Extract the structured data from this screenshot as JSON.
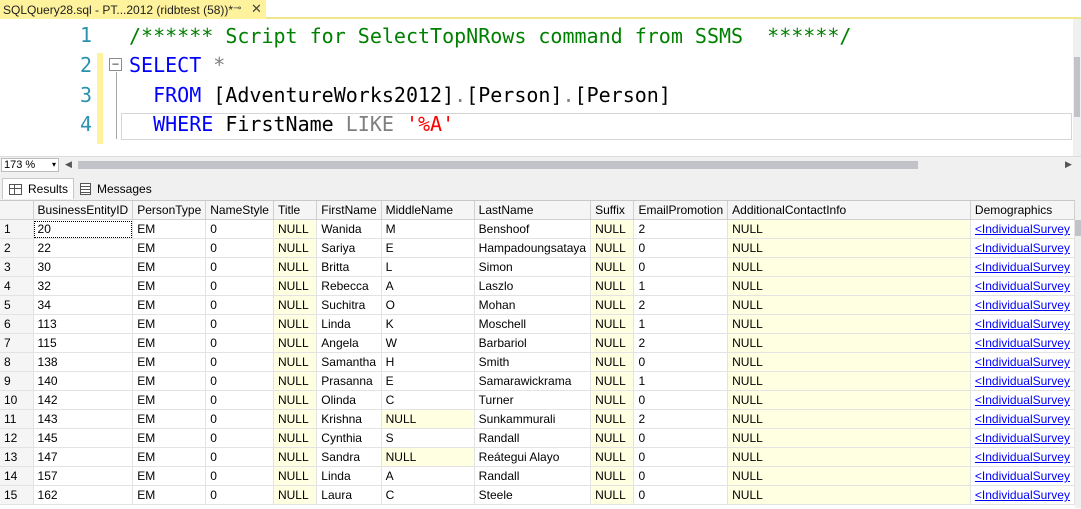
{
  "document_tab": {
    "title": "SQLQuery28.sql - PT...2012 (ridbtest (58))*",
    "pin_icon": "pin-icon",
    "close_icon": "close-icon"
  },
  "editor": {
    "line_numbers": [
      "1",
      "2",
      "3",
      "4"
    ],
    "lines": [
      {
        "parts": [
          {
            "t": "/****** Script for SelectTopNRows command from SSMS  ******/",
            "c": "cm"
          }
        ]
      },
      {
        "parts": [
          {
            "t": "SELECT",
            "c": "kw"
          },
          {
            "t": " *",
            "c": "gr"
          }
        ]
      },
      {
        "parts": [
          {
            "t": "  FROM",
            "c": "kw"
          },
          {
            "t": " [AdventureWorks2012]",
            "c": ""
          },
          {
            "t": ".",
            "c": "gr"
          },
          {
            "t": "[Person]",
            "c": ""
          },
          {
            "t": ".",
            "c": "gr"
          },
          {
            "t": "[Person]",
            "c": ""
          }
        ]
      },
      {
        "parts": [
          {
            "t": "  WHERE",
            "c": "kw"
          },
          {
            "t": " FirstName ",
            "c": ""
          },
          {
            "t": "LIKE",
            "c": "gr"
          },
          {
            "t": " ",
            "c": ""
          },
          {
            "t": "'%A'",
            "c": "str"
          }
        ]
      }
    ],
    "collapse_glyph": "−"
  },
  "zoom": {
    "value": "173 %",
    "arrow": "▾"
  },
  "result_tabs": {
    "results": "Results",
    "messages": "Messages"
  },
  "grid": {
    "columns": [
      "",
      "BusinessEntityID",
      "PersonType",
      "NameStyle",
      "Title",
      "FirstName",
      "MiddleName",
      "LastName",
      "Suffix",
      "EmailPromotion",
      "AdditionalContactInfo",
      "Demographics"
    ],
    "rows": [
      [
        "1",
        "20",
        "EM",
        "0",
        "NULL",
        "Wanida",
        "M",
        "Benshoof",
        "NULL",
        "2",
        "NULL",
        "<IndividualSurvey"
      ],
      [
        "2",
        "22",
        "EM",
        "0",
        "NULL",
        "Sariya",
        "E",
        "Hampadoungsataya",
        "NULL",
        "0",
        "NULL",
        "<IndividualSurvey"
      ],
      [
        "3",
        "30",
        "EM",
        "0",
        "NULL",
        "Britta",
        "L",
        "Simon",
        "NULL",
        "0",
        "NULL",
        "<IndividualSurvey"
      ],
      [
        "4",
        "32",
        "EM",
        "0",
        "NULL",
        "Rebecca",
        "A",
        "Laszlo",
        "NULL",
        "1",
        "NULL",
        "<IndividualSurvey"
      ],
      [
        "5",
        "34",
        "EM",
        "0",
        "NULL",
        "Suchitra",
        "O",
        "Mohan",
        "NULL",
        "2",
        "NULL",
        "<IndividualSurvey"
      ],
      [
        "6",
        "113",
        "EM",
        "0",
        "NULL",
        "Linda",
        "K",
        "Moschell",
        "NULL",
        "1",
        "NULL",
        "<IndividualSurvey"
      ],
      [
        "7",
        "115",
        "EM",
        "0",
        "NULL",
        "Angela",
        "W",
        "Barbariol",
        "NULL",
        "2",
        "NULL",
        "<IndividualSurvey"
      ],
      [
        "8",
        "138",
        "EM",
        "0",
        "NULL",
        "Samantha",
        "H",
        "Smith",
        "NULL",
        "0",
        "NULL",
        "<IndividualSurvey"
      ],
      [
        "9",
        "140",
        "EM",
        "0",
        "NULL",
        "Prasanna",
        "E",
        "Samarawickrama",
        "NULL",
        "1",
        "NULL",
        "<IndividualSurvey"
      ],
      [
        "10",
        "142",
        "EM",
        "0",
        "NULL",
        "Olinda",
        "C",
        "Turner",
        "NULL",
        "0",
        "NULL",
        "<IndividualSurvey"
      ],
      [
        "11",
        "143",
        "EM",
        "0",
        "NULL",
        "Krishna",
        "NULL",
        "Sunkammurali",
        "NULL",
        "2",
        "NULL",
        "<IndividualSurvey"
      ],
      [
        "12",
        "145",
        "EM",
        "0",
        "NULL",
        "Cynthia",
        "S",
        "Randall",
        "NULL",
        "0",
        "NULL",
        "<IndividualSurvey"
      ],
      [
        "13",
        "147",
        "EM",
        "0",
        "NULL",
        "Sandra",
        "NULL",
        "Reátegui Alayo",
        "NULL",
        "0",
        "NULL",
        "<IndividualSurvey"
      ],
      [
        "14",
        "157",
        "EM",
        "0",
        "NULL",
        "Linda",
        "A",
        "Randall",
        "NULL",
        "0",
        "NULL",
        "<IndividualSurvey"
      ],
      [
        "15",
        "162",
        "EM",
        "0",
        "NULL",
        "Laura",
        "C",
        "Steele",
        "NULL",
        "0",
        "NULL",
        "<IndividualSurvey"
      ]
    ]
  },
  "colors": {
    "keyword": "#0000ff",
    "comment": "#008000",
    "string": "#ff0000",
    "line_number": "#2b91af",
    "null_cell": "#ffffe1",
    "tab_highlight": "#fff29d"
  }
}
